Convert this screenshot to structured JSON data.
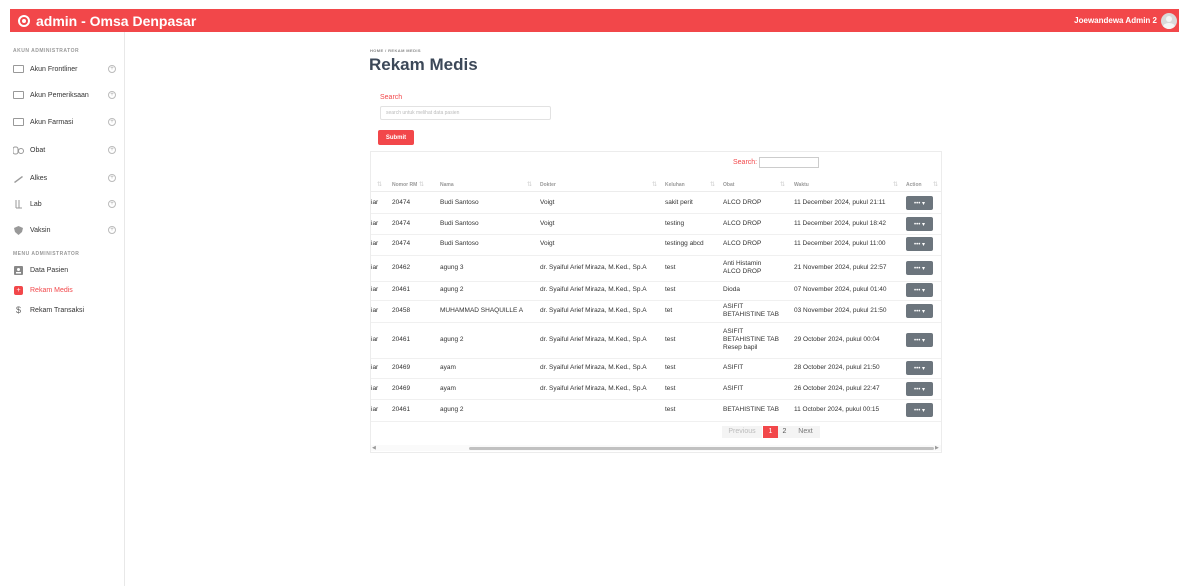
{
  "topbar": {
    "title": "admin - Omsa Denpasar",
    "user": "Joewandewa Admin 2"
  },
  "sidebar": {
    "heading1": "AKUN ADMINISTRATOR",
    "heading2": "MENU ADMINISTRATOR",
    "items1": [
      "Akun Frontliner",
      "Akun Pemeriksaan",
      "Akun Farmasi",
      "Obat",
      "Alkes",
      "Lab",
      "Vaksin"
    ],
    "items2": [
      "Data Pasien",
      "Rekam Medis",
      "Rekam Transaksi"
    ],
    "plus": "+"
  },
  "breadcrumb": "HOME / REKAM MEDIS",
  "page_title": "Rekam Medis",
  "form": {
    "label": "Search",
    "placeholder": "search untuk melihat data pasien",
    "submit": "Submit"
  },
  "table": {
    "search_label": "Search:",
    "headers": [
      "Nomor RM",
      "Nama",
      "Dokter",
      "Keluhan",
      "Obat",
      "Waktu",
      "Action"
    ],
    "rows": [
      {
        "pre": "iar",
        "rm": "20474",
        "nama": "Budi Santoso",
        "dokter": "Voigt",
        "keluhan": "sakit perit",
        "obat": [
          "ALCO DROP"
        ],
        "waktu": "11 December 2024, pukul 21:11"
      },
      {
        "pre": "iar",
        "rm": "20474",
        "nama": "Budi Santoso",
        "dokter": "Voigt",
        "keluhan": "testing",
        "obat": [
          "ALCO DROP"
        ],
        "waktu": "11 December 2024, pukul 18:42"
      },
      {
        "pre": "iar",
        "rm": "20474",
        "nama": "Budi Santoso",
        "dokter": "Voigt",
        "keluhan": "testingg abcd",
        "obat": [
          "ALCO DROP"
        ],
        "waktu": "11 December 2024, pukul 11:00"
      },
      {
        "pre": "iar",
        "rm": "20462",
        "nama": "agung 3",
        "dokter": "dr. Syaiful Arief Miraza, M.Ked., Sp.A",
        "keluhan": "test",
        "obat": [
          "Anti Histamin",
          "ALCO DROP"
        ],
        "waktu": "21 November 2024, pukul 22:57"
      },
      {
        "pre": "iar",
        "rm": "20461",
        "nama": "agung 2",
        "dokter": "dr. Syaiful Arief Miraza, M.Ked., Sp.A",
        "keluhan": "test",
        "obat": [
          "Dioda"
        ],
        "waktu": "07 November 2024, pukul 01:40"
      },
      {
        "pre": "iar",
        "rm": "20458",
        "nama": "MUHAMMAD SHAQUILLE A",
        "dokter": "dr. Syaiful Arief Miraza, M.Ked., Sp.A",
        "keluhan": "tet",
        "obat": [
          "ASIFIT",
          "BETAHISTINE TAB"
        ],
        "waktu": "03 November 2024, pukul 21:50"
      },
      {
        "pre": "iar",
        "rm": "20461",
        "nama": "agung 2",
        "dokter": "dr. Syaiful Arief Miraza, M.Ked., Sp.A",
        "keluhan": "test",
        "obat": [
          "ASIFIT",
          "BETAHISTINE TAB",
          "Resep bapil"
        ],
        "waktu": "29 October 2024, pukul 00:04"
      },
      {
        "pre": "iar",
        "rm": "20469",
        "nama": "ayam",
        "dokter": "dr. Syaiful Arief Miraza, M.Ked., Sp.A",
        "keluhan": "test",
        "obat": [
          "ASIFIT"
        ],
        "waktu": "28 October 2024, pukul 21:50"
      },
      {
        "pre": "iar",
        "rm": "20469",
        "nama": "ayam",
        "dokter": "dr. Syaiful Arief Miraza, M.Ked., Sp.A",
        "keluhan": "test",
        "obat": [
          "ASIFIT"
        ],
        "waktu": "26 October 2024, pukul 22:47"
      },
      {
        "pre": "iar",
        "rm": "20461",
        "nama": "agung 2",
        "dokter": "",
        "keluhan": "test",
        "obat": [
          "BETAHISTINE TAB"
        ],
        "waktu": "11 October 2024, pukul 00:15"
      }
    ],
    "action_label": "••• ▾"
  },
  "pagination": {
    "prev": "Previous",
    "pages": [
      "1",
      "2"
    ],
    "next": "Next"
  },
  "scrollbar": {
    "left": "◀",
    "right": "▶"
  },
  "colors": {
    "accent": "#f2474a",
    "action": "#6c757d"
  }
}
